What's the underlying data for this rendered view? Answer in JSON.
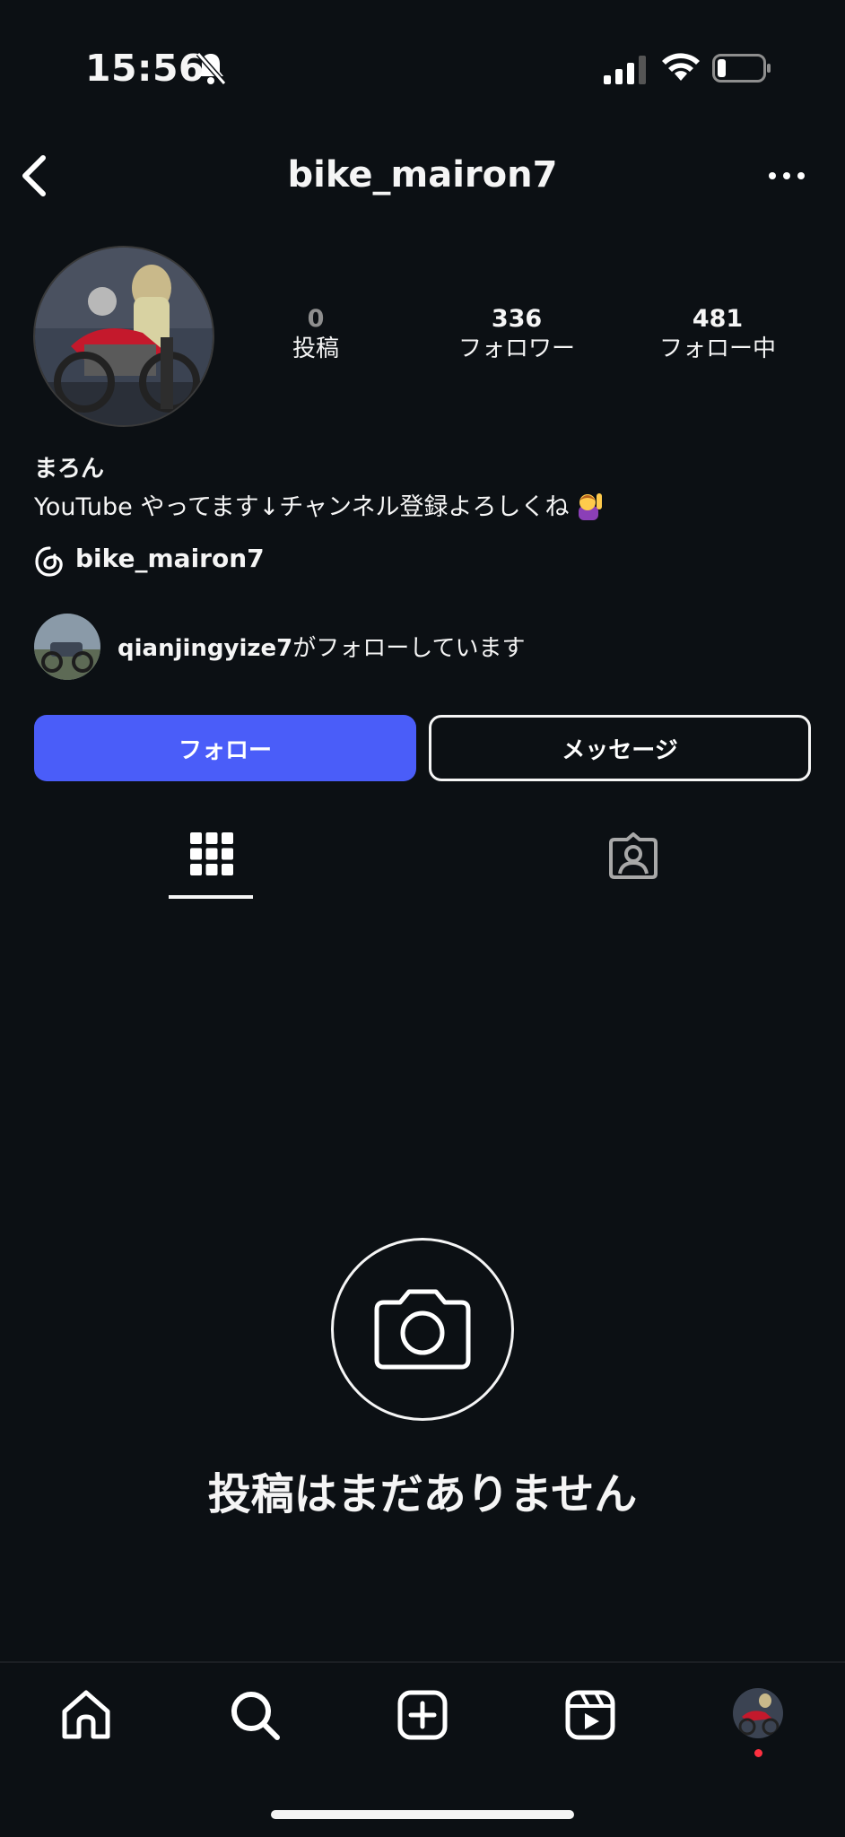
{
  "status_bar": {
    "time": "15:56",
    "icons": [
      "bell-slash-icon",
      "cellular-signal-icon",
      "wifi-icon",
      "battery-icon"
    ]
  },
  "header": {
    "username": "bike_mairon7",
    "back_icon": "chevron-left-icon",
    "more_icon": "ellipsis-icon"
  },
  "profile": {
    "stats": [
      {
        "value": "0",
        "label": "投稿"
      },
      {
        "value": "336",
        "label": "フォロワー"
      },
      {
        "value": "481",
        "label": "フォロー中"
      }
    ],
    "display_name": "まろん",
    "bio": "YouTube やってます↓チャンネル登録よろしくね",
    "bio_emoji": "person-raising-hand-emoji",
    "threads_handle": "bike_mairon7",
    "mutual": {
      "username": "qianjingyize7",
      "suffix": "がフォローしています"
    }
  },
  "actions": {
    "follow_label": "フォロー",
    "message_label": "メッセージ"
  },
  "tabs": [
    {
      "icon": "grid-icon",
      "active": true
    },
    {
      "icon": "tagged-person-icon",
      "active": false
    }
  ],
  "empty_state": {
    "icon": "camera-icon",
    "text": "投稿はまだありません"
  },
  "bottom_nav": [
    {
      "icon": "home-icon"
    },
    {
      "icon": "search-icon"
    },
    {
      "icon": "create-icon"
    },
    {
      "icon": "reels-icon"
    },
    {
      "icon": "profile-avatar"
    }
  ],
  "colors": {
    "background": "#0c1014",
    "accent": "#4a5df9",
    "notification_dot": "#ff3040"
  }
}
